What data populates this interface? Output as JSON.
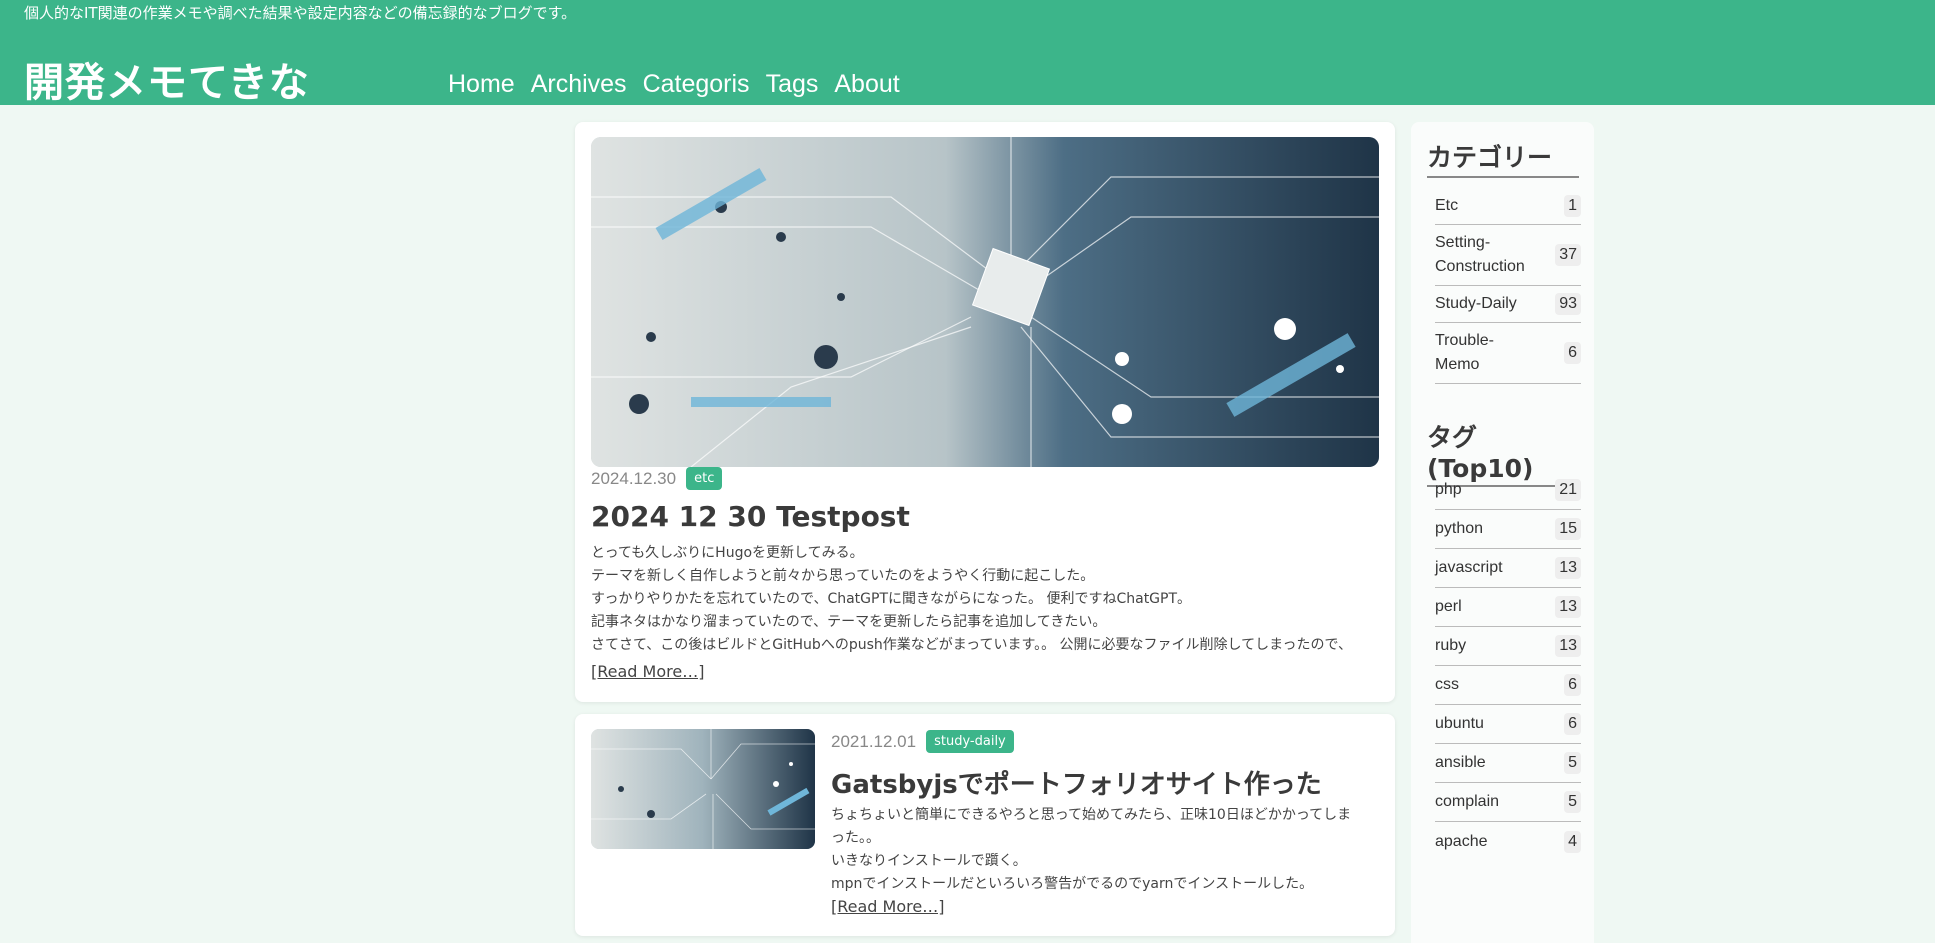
{
  "header": {
    "tagline": "個人的なIT関連の作業メモや調べた結果や設定内容などの備忘録的なブログです。",
    "site_title": "開発メモてきな",
    "nav": [
      "Home",
      "Archives",
      "Categoris",
      "Tags",
      "About"
    ]
  },
  "posts": [
    {
      "date": "2024.12.30",
      "category": "etc",
      "title": "2024 12 30 Testpost",
      "excerpt": [
        "とっても久しぶりにHugoを更新してみる。",
        "テーマを新しく自作しようと前々から思っていたのをようやく行動に起こした。",
        "すっかりやりかたを忘れていたので、ChatGPTに聞きながらになった。 便利ですねChatGPT。",
        "記事ネタはかなり溜まっていたので、テーマを更新したら記事を追加してきたい。",
        "さてさて、この後はビルドとGitHubへのpush作業などがまっています。。 公開に必要なファイル削除してしまったので、"
      ],
      "read_more": "[Read More…]"
    },
    {
      "date": "2021.12.01",
      "category": "study-daily",
      "title": "Gatsbyjsでポートフォリオサイト作った",
      "excerpt": [
        "ちょちょいと簡単にできるやろと思って始めてみたら、正味10日ほどかかってしま",
        "った。。",
        "いきなりインストールで躓く。",
        "mpnでインストールだといろいろ警告がでるのでyarnでインストールした。"
      ],
      "read_more": "[Read More…]"
    }
  ],
  "sidebar": {
    "categories_heading": "カテゴリー",
    "categories": [
      {
        "name": "Etc",
        "count": "1"
      },
      {
        "name": "Setting-Construction",
        "count": "37"
      },
      {
        "name": "Study-Daily",
        "count": "93"
      },
      {
        "name": "Trouble-Memo",
        "count": "6"
      }
    ],
    "tags_heading": "タグ(Top10)",
    "tags": [
      {
        "name": "php",
        "count": "21"
      },
      {
        "name": "python",
        "count": "15"
      },
      {
        "name": "javascript",
        "count": "13"
      },
      {
        "name": "perl",
        "count": "13"
      },
      {
        "name": "ruby",
        "count": "13"
      },
      {
        "name": "css",
        "count": "6"
      },
      {
        "name": "ubuntu",
        "count": "6"
      },
      {
        "name": "ansible",
        "count": "5"
      },
      {
        "name": "complain",
        "count": "5"
      },
      {
        "name": "apache",
        "count": "4"
      }
    ]
  },
  "colors": {
    "header_bg": "#3cb58a",
    "page_bg": "#eff8f3",
    "badge_bg": "#3cb58a"
  }
}
